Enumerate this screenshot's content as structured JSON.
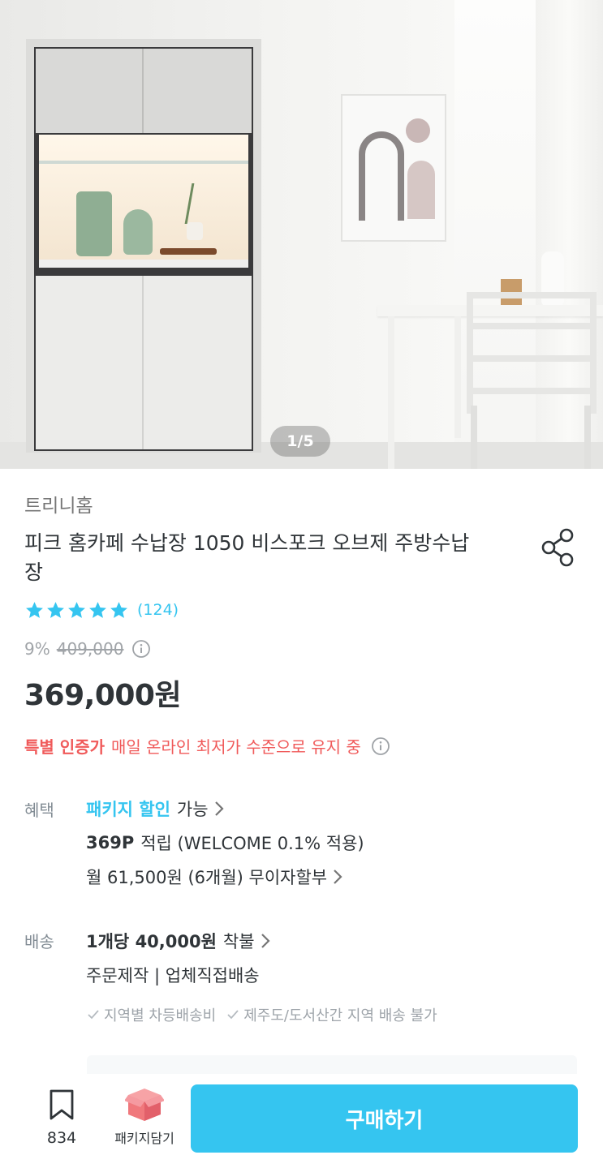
{
  "gallery": {
    "indicator": "1/5",
    "current": 1,
    "total": 5
  },
  "product": {
    "brand": "트리니홈",
    "title": "피크 홈카페 수납장 1050 비스포크 오브제 주방수납장",
    "rating": 5,
    "review_count": "(124)",
    "discount": "9%",
    "original_price": "409,000",
    "price": "369,000원"
  },
  "special_price": {
    "label": "특별 인증가",
    "text": "매일 온라인 최저가 수준으로 유지 중"
  },
  "benefits": {
    "label": "혜택",
    "package_strong": "패키지 할인",
    "package_rest": "가능",
    "points_strong": "369P",
    "points_rest": "적립 (WELCOME 0.1% 적용)",
    "installment": "월 61,500원 (6개월) 무이자할부"
  },
  "shipping": {
    "label": "배송",
    "fee_strong": "1개당 40,000원",
    "fee_rest": "착불",
    "method": "주문제작 | 업체직접배송",
    "notes": [
      "지역별 차등배송비",
      "제주도/도서산간 지역 배송 불가"
    ]
  },
  "bottom_bar": {
    "bookmark_count": "834",
    "package_label": "패키지담기",
    "buy_label": "구매하기"
  },
  "colors": {
    "accent": "#35c5f0",
    "sale_red": "#f05a5a",
    "text": "#2f3438",
    "muted": "#828c94",
    "package_icon": "#f0787c"
  },
  "icons": [
    "share-icon",
    "star-icon",
    "info-icon",
    "chevron-right-icon",
    "check-icon",
    "bookmark-icon",
    "package-box-icon"
  ]
}
